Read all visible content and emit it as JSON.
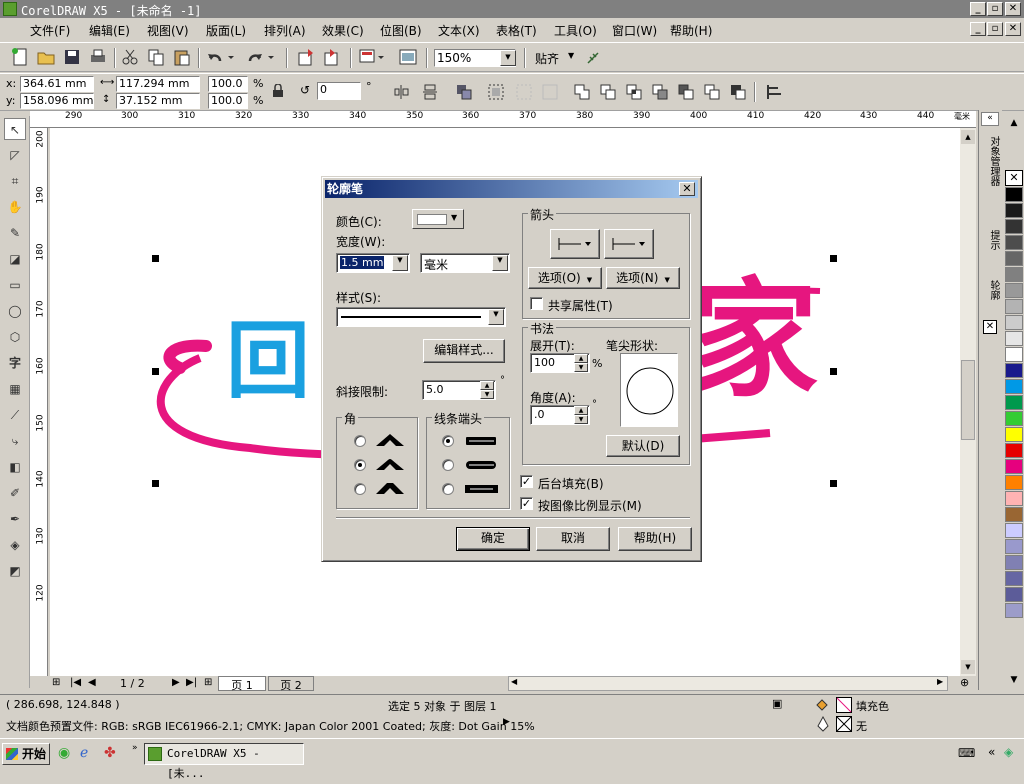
{
  "window": {
    "title": "CorelDRAW X5 - [未命名 -1]",
    "min": "_",
    "max": "▫",
    "close": "✕"
  },
  "menu": [
    "文件(F)",
    "编辑(E)",
    "视图(V)",
    "版面(L)",
    "排列(A)",
    "效果(C)",
    "位图(B)",
    "文本(X)",
    "表格(T)",
    "工具(O)",
    "窗口(W)",
    "帮助(H)"
  ],
  "toolbar": {
    "zoom": "150%",
    "snap": "贴齐"
  },
  "property_bar": {
    "x": "364.61 mm",
    "y": "158.096 mm",
    "w": "117.294 mm",
    "h": "37.152 mm",
    "scale_x": "100.0",
    "scale_y": "100.0",
    "pct": "%",
    "rotation": "0",
    "deg": "°"
  },
  "ruler": {
    "h_ticks": [
      "290",
      "300",
      "310",
      "320",
      "330",
      "340",
      "350",
      "360",
      "370",
      "380",
      "390",
      "400",
      "410",
      "420",
      "430",
      "440"
    ],
    "h_unit": "毫米",
    "v_ticks": [
      "200",
      "190",
      "180",
      "170",
      "160",
      "150",
      "140",
      "130",
      "120"
    ]
  },
  "canvas": {
    "text_blue": "回",
    "text_pink": "家",
    "blue": "#1aa0e0",
    "pink": "#e6167f"
  },
  "docker_tabs": [
    "对象管理器",
    "提示",
    "轮廓"
  ],
  "palette": [
    "#000000",
    "#1a1a1a",
    "#333333",
    "#4d4d4d",
    "#666666",
    "#808080",
    "#999999",
    "#b3b3b3",
    "#cccccc",
    "#e6e6e6",
    "#ffffff",
    "#1a1a8c",
    "#0099e6",
    "#00994d",
    "#33cc33",
    "#ffff00",
    "#e60000",
    "#e6007e",
    "#ff8000",
    "#ffb3b3",
    "#996633",
    "#ccccff",
    "#9999cc",
    "#8080b3",
    "#6666a3",
    "#5c5c99",
    "#9c9cc9"
  ],
  "dialog": {
    "title": "轮廓笔",
    "color_label": "颜色(C):",
    "width_label": "宽度(W):",
    "width_value": "1.5 mm",
    "unit_value": "毫米",
    "style_label": "样式(S):",
    "edit_style": "编辑样式...",
    "miter_label": "斜接限制:",
    "miter_value": "5.0",
    "deg": "°",
    "corner_label": "角",
    "linecaps_label": "线条端头",
    "arrows_label": "箭头",
    "options_left": "选项(O)",
    "options_right": "选项(N)",
    "share_attr": "共享属性(T)",
    "calligraphy_label": "书法",
    "stretch_label": "展开(T):",
    "stretch_value": "100",
    "pct": "%",
    "nib_shape": "笔尖形状:",
    "angle_label": "角度(A):",
    "angle_value": ".0",
    "default_btn": "默认(D)",
    "behind_fill": "后台填充(B)",
    "scale_with_image": "按图像比例显示(M)",
    "ok": "确定",
    "cancel": "取消",
    "help": "帮助(H)"
  },
  "pages": {
    "count": "1 / 2",
    "tab1": "页 1",
    "tab2": "页 2"
  },
  "status": {
    "coords": "( 286.698, 124.848 )",
    "selection": "选定 5 对象 于 图层 1",
    "fill_label": "填充色",
    "outline_label": "无",
    "profile": "文档颜色预置文件: RGB: sRGB IEC61966-2.1; CMYK: Japan Color 2001 Coated; 灰度: Dot Gain 15%"
  },
  "taskbar": {
    "start": "开始",
    "task": "CorelDRAW X5 - [未..."
  }
}
